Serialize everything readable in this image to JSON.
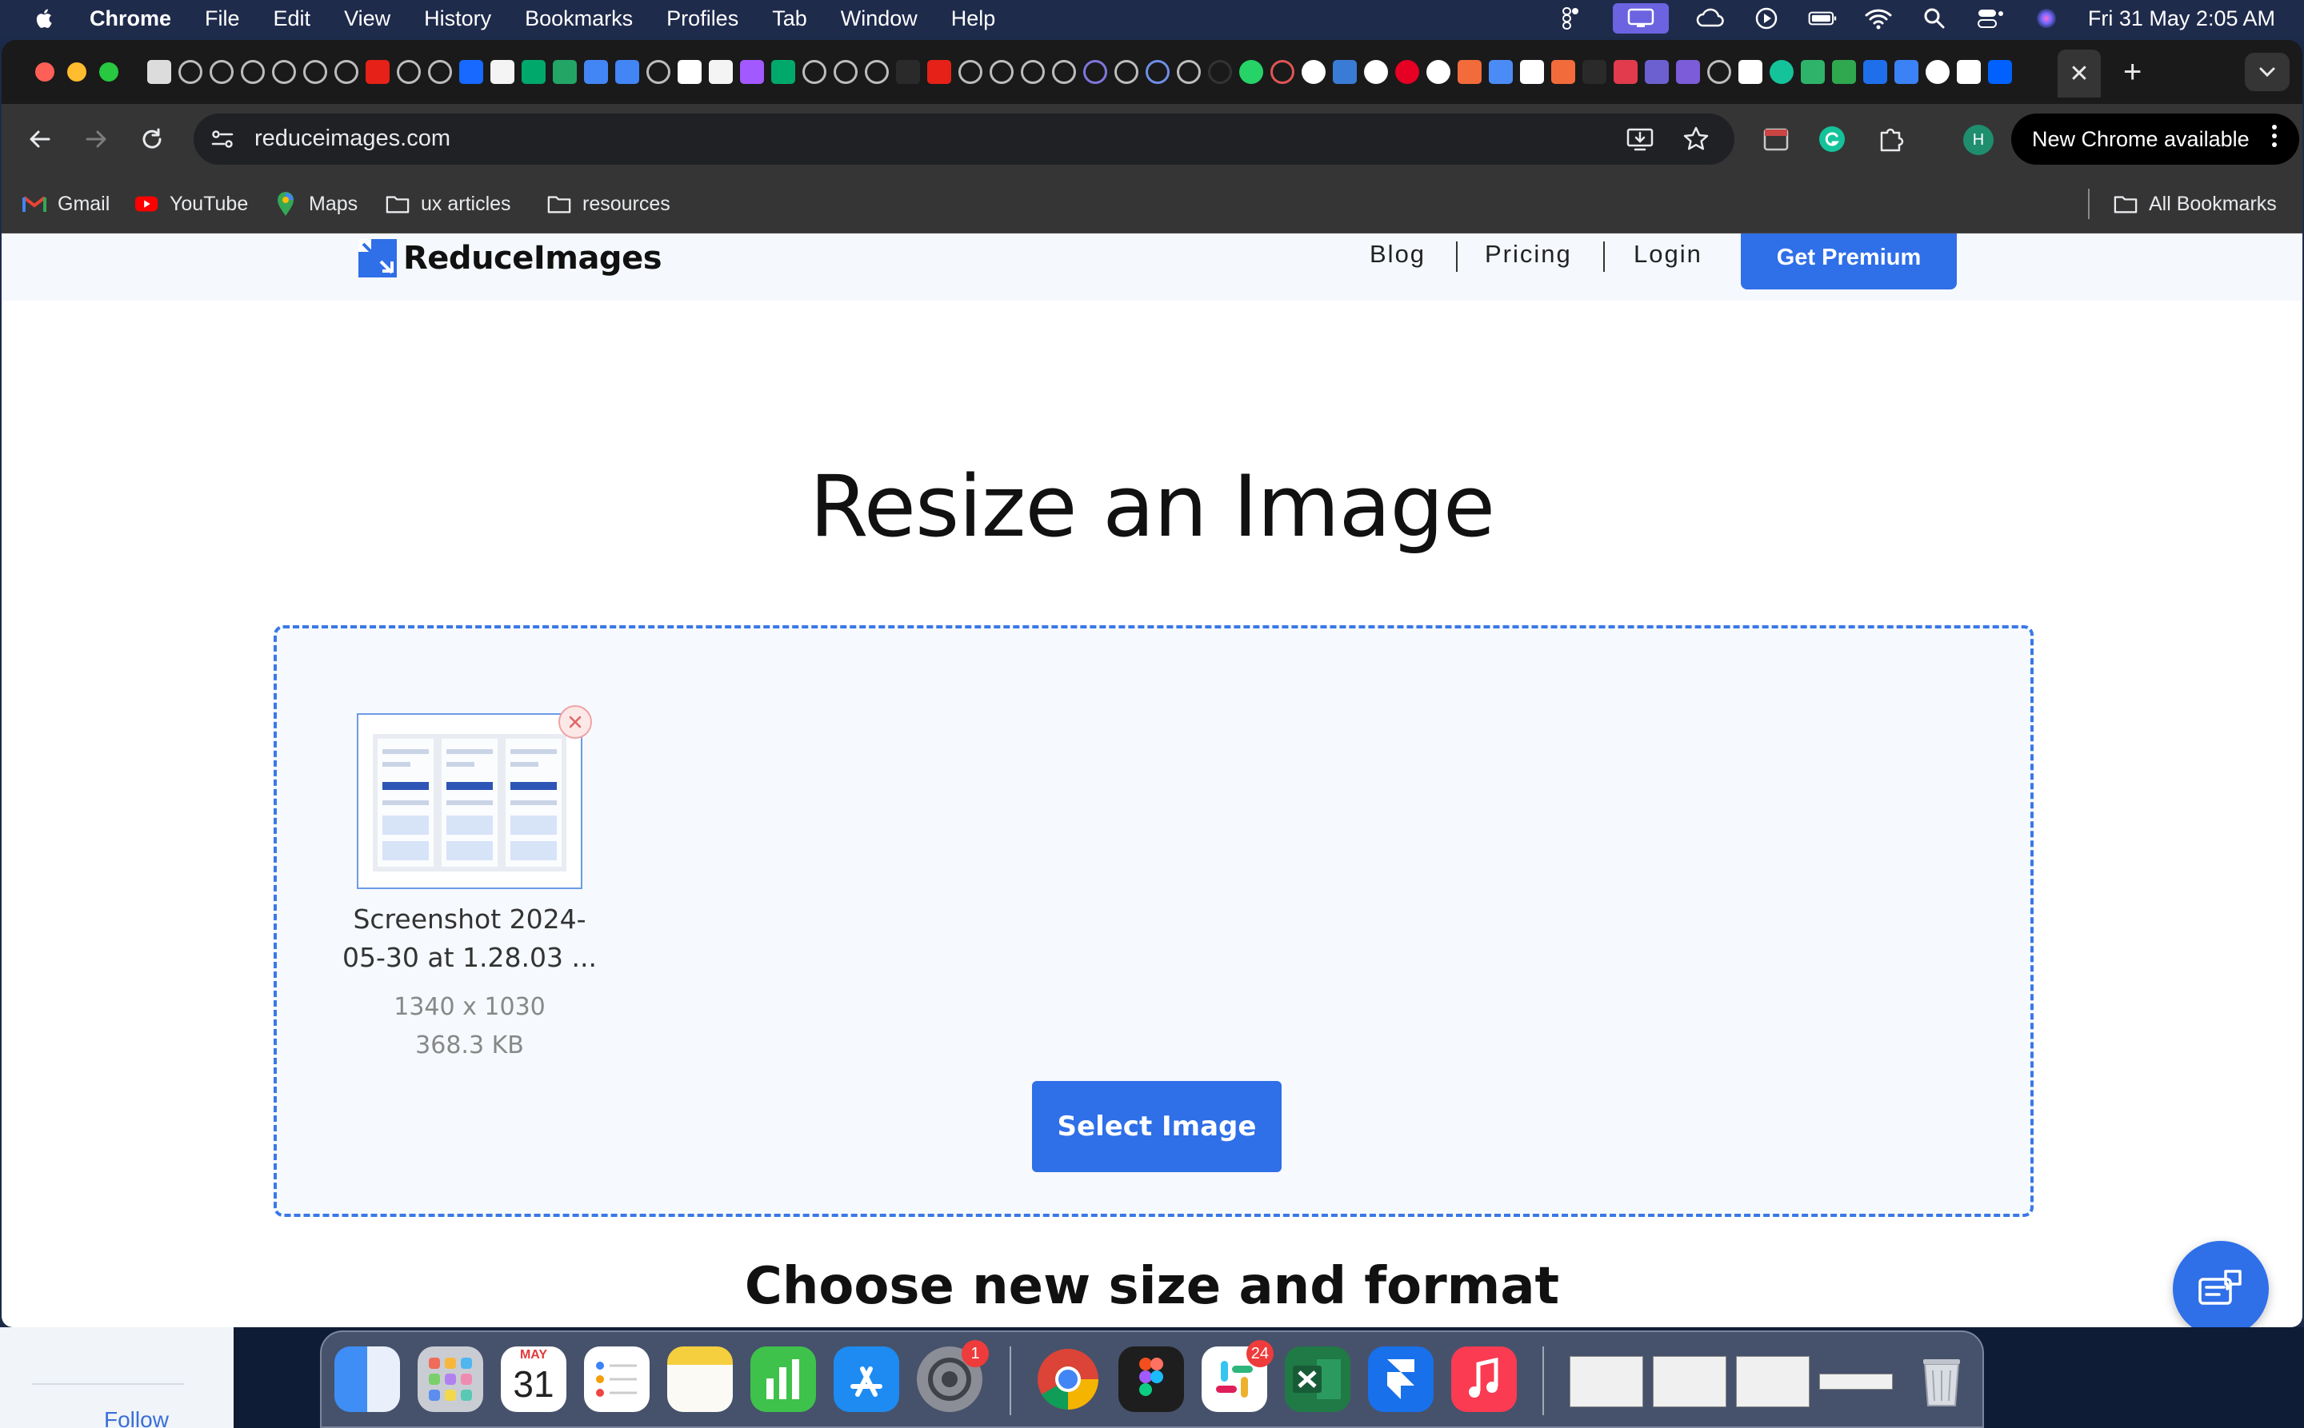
{
  "menubar": {
    "app_name": "Chrome",
    "items": [
      "File",
      "Edit",
      "View",
      "History",
      "Bookmarks",
      "Profiles",
      "Tab",
      "Window",
      "Help"
    ],
    "clock": "Fri 31 May  2:05 AM",
    "status_icons": [
      "figma-menubar-icon",
      "screen-share-icon",
      "creative-cloud-icon",
      "play-icon",
      "battery-icon",
      "wifi-icon",
      "spotlight-search-icon",
      "control-center-icon",
      "siri-icon"
    ]
  },
  "browser": {
    "tab_close_glyph": "✕",
    "new_tab_glyph": "+",
    "url": "reduceimages.com",
    "profile_initial": "H",
    "update_label": "New Chrome available",
    "bookmarks": [
      "Gmail",
      "YouTube",
      "Maps",
      "ux articles",
      "resources"
    ],
    "all_bookmarks_label": "All Bookmarks"
  },
  "site": {
    "logo_text": "ReduceImages",
    "nav": [
      "Blog",
      "Pricing",
      "Login"
    ],
    "premium_label": "Get Premium",
    "page_title": "Resize an Image",
    "file": {
      "name_line1": "Screenshot 2024-",
      "name_line2": "05-30 at 1.28.03 ...",
      "dimensions": "1340 x 1030",
      "size": "368.3 KB"
    },
    "select_label": "Select Image",
    "section_title": "Choose new size and format"
  },
  "desktop": {
    "background_window_text": "Follow",
    "calendar_month": "MAY",
    "calendar_day": "31",
    "settings_badge": "1",
    "slack_badge": "24"
  },
  "colors": {
    "accent": "#2f6fe8",
    "dropzone_border": "#3a78e6",
    "menubar_bg": "#1f2b4b"
  }
}
